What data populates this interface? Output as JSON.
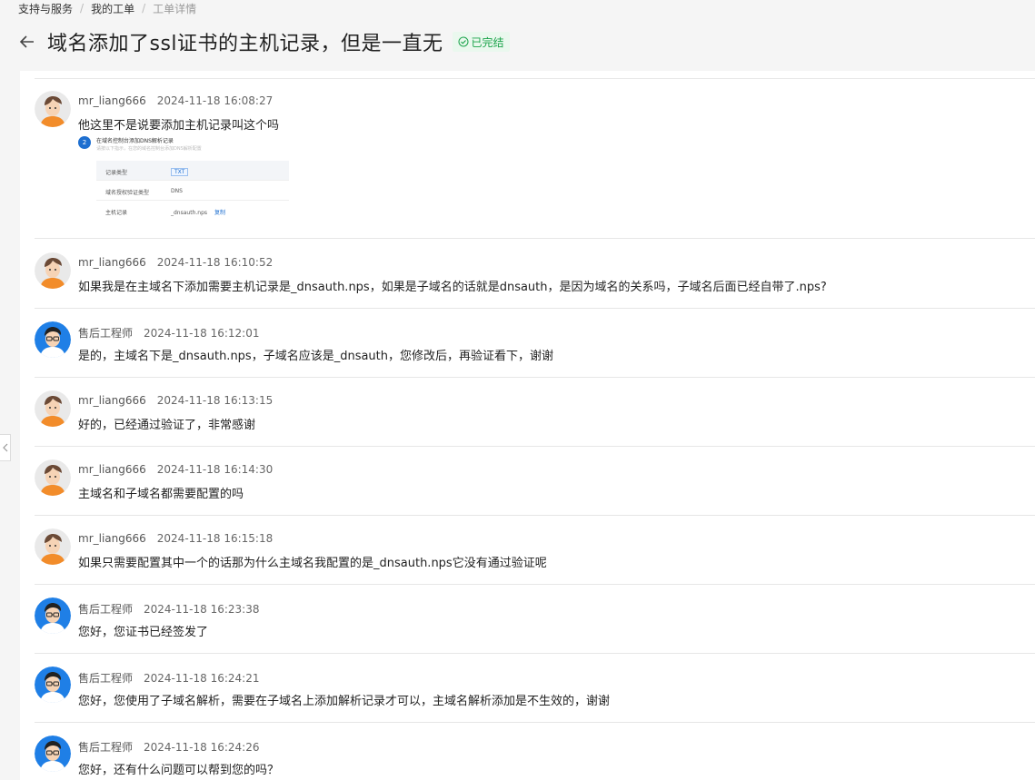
{
  "breadcrumb": [
    "支持与服务",
    "我的工单",
    "工单详情"
  ],
  "title": "域名添加了ssl证书的主机记录，但是一直无",
  "status": "已完结",
  "attachment": {
    "step": "2",
    "heading": "在域名控制台添加DNS解析记录",
    "subheading": "请按以下指示，在您的域名控制台添加DNS解析配置",
    "rows": [
      {
        "key": "记录类型",
        "value": "TXT"
      },
      {
        "key": "域名授权验证类型",
        "value": "DNS"
      },
      {
        "key": "主机记录",
        "value": "_dnsauth.nps",
        "action": "复制"
      }
    ]
  },
  "messages": [
    {
      "author": "mr_liang666",
      "role": "user",
      "time": "2024-11-18 16:08:27",
      "text": "他这里不是说要添加主机记录叫这个吗"
    },
    {
      "author": "mr_liang666",
      "role": "user",
      "time": "2024-11-18 16:10:52",
      "text": "如果我是在主域名下添加需要主机记录是_dnsauth.nps，如果是子域名的话就是dnsauth，是因为域名的关系吗，子域名后面已经自带了.nps?"
    },
    {
      "author": "售后工程师",
      "role": "engineer",
      "time": "2024-11-18 16:12:01",
      "text": "是的，主域名下是_dnsauth.nps，子域名应该是_dnsauth，您修改后，再验证看下，谢谢"
    },
    {
      "author": "mr_liang666",
      "role": "user",
      "time": "2024-11-18 16:13:15",
      "text": "好的，已经通过验证了，非常感谢"
    },
    {
      "author": "mr_liang666",
      "role": "user",
      "time": "2024-11-18 16:14:30",
      "text": "主域名和子域名都需要配置的吗"
    },
    {
      "author": "mr_liang666",
      "role": "user",
      "time": "2024-11-18 16:15:18",
      "text": "如果只需要配置其中一个的话那为什么主域名我配置的是_dnsauth.nps它没有通过验证呢"
    },
    {
      "author": "售后工程师",
      "role": "engineer",
      "time": "2024-11-18 16:23:38",
      "text": "您好，您证书已经签发了"
    },
    {
      "author": "售后工程师",
      "role": "engineer",
      "time": "2024-11-18 16:24:21",
      "text": "您好，您使用了子域名解析，需要在子域名上添加解析记录才可以，主域名解析添加是不生效的，谢谢"
    },
    {
      "author": "售后工程师",
      "role": "engineer",
      "time": "2024-11-18 16:24:26",
      "text": "您好，还有什么问题可以帮到您的吗？"
    }
  ]
}
